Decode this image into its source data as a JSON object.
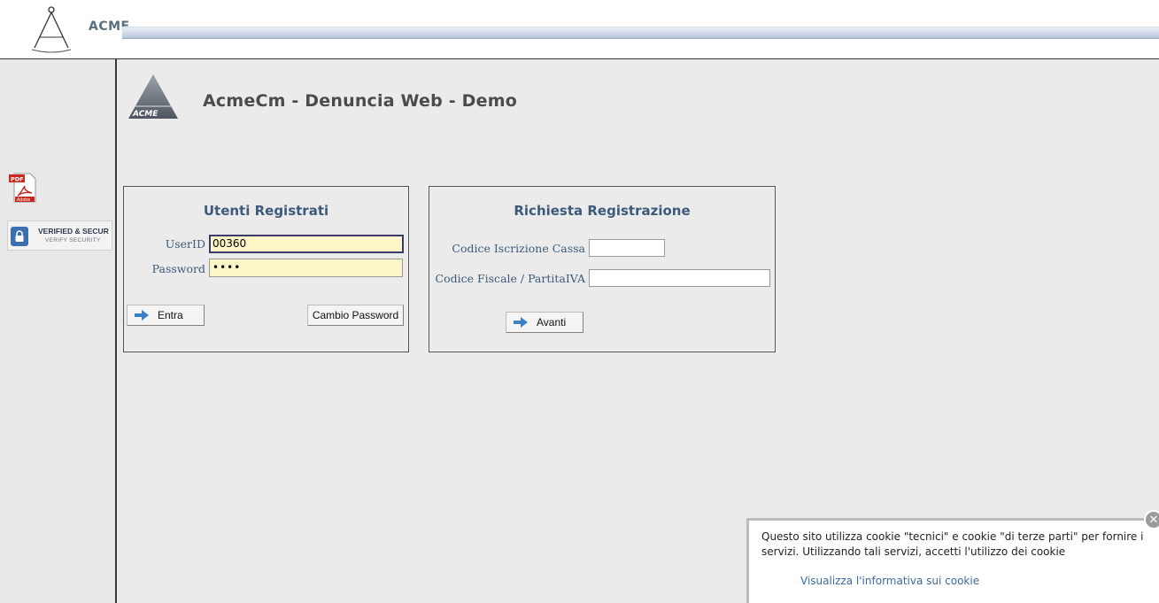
{
  "header": {
    "brand": "ACME"
  },
  "main": {
    "title": "AcmeCm - Denuncia Web - Demo",
    "logo_text": "ACME"
  },
  "sidebar": {
    "pdf_badge": "PDF",
    "pdf_sub": "Adobe",
    "verified_line1": "VERIFIED & SECUR",
    "verified_line2": "VERIFY SECURITY"
  },
  "login": {
    "title": "Utenti Registrati",
    "userid_label": "UserID",
    "userid_value": "00360",
    "password_label": "Password",
    "password_value": "••••",
    "enter_label": "Entra",
    "change_password_label": "Cambio Password"
  },
  "registration": {
    "title": "Richiesta Registrazione",
    "code_label": "Codice Iscrizione Cassa",
    "code_value": "",
    "fiscal_label": "Codice Fiscale / PartitaIVA",
    "fiscal_value": "",
    "next_label": "Avanti"
  },
  "cookie": {
    "text": "Questo sito utilizza cookie \"tecnici\" e cookie \"di terze parti\" per fornire i servizi. Utilizzando tali servizi, accetti l'utilizzo dei cookie",
    "link": "Visualizza l'informativa sui cookie",
    "close_glyph": "✕"
  },
  "colors": {
    "accent": "#3d5a7a",
    "input_highlight": "#fcf5c7",
    "link": "#3a6aa0"
  }
}
